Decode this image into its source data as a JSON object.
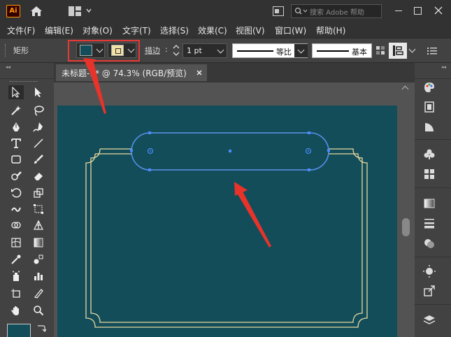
{
  "app": {
    "logo": "Ai",
    "search_placeholder": "搜索 Adobe 帮助"
  },
  "menu": [
    "文件(F)",
    "编辑(E)",
    "对象(O)",
    "文字(T)",
    "选择(S)",
    "效果(C)",
    "视图(V)",
    "窗口(W)",
    "帮助(H)"
  ],
  "control": {
    "shape_label": "矩形",
    "fill_color": "#134d59",
    "stroke_color": "#f2e1a6",
    "stroke_label": "描边",
    "stroke_weight": "1 pt",
    "profile_label": "等比",
    "brush_label": "基本"
  },
  "document": {
    "tab_title": "未标题-1* @ 74.3% (RGB/预览)"
  },
  "colors": {
    "artboard": "#134d59",
    "frame_line": "#e7d9a0",
    "selection": "#4a8cff",
    "annotation": "#e8332a"
  },
  "icons": {
    "left_tools": [
      "selection-icon",
      "direct-selection-icon",
      "magic-wand-icon",
      "lasso-icon",
      "pen-icon",
      "curvature-icon",
      "type-icon",
      "line-segment-icon",
      "rectangle-icon",
      "paintbrush-icon",
      "shaper-icon",
      "eraser-icon",
      "rotate-icon",
      "scale-icon",
      "warp-icon",
      "free-transform-icon",
      "shape-builder-icon",
      "perspective-grid-icon",
      "mesh-icon",
      "gradient-icon",
      "eyedropper-icon",
      "blend-icon",
      "symbol-sprayer-icon",
      "column-graph-icon",
      "artboard-icon",
      "slice-icon",
      "hand-icon",
      "zoom-icon"
    ],
    "right_panels": [
      "color-palette-icon",
      "properties-icon",
      "color-guide-icon",
      "symbols-icon",
      "swatches-icon",
      "gradient-panel-icon",
      "stroke-panel-icon",
      "transparency-icon",
      "appearance-icon",
      "export-icon",
      "layers-icon"
    ]
  }
}
